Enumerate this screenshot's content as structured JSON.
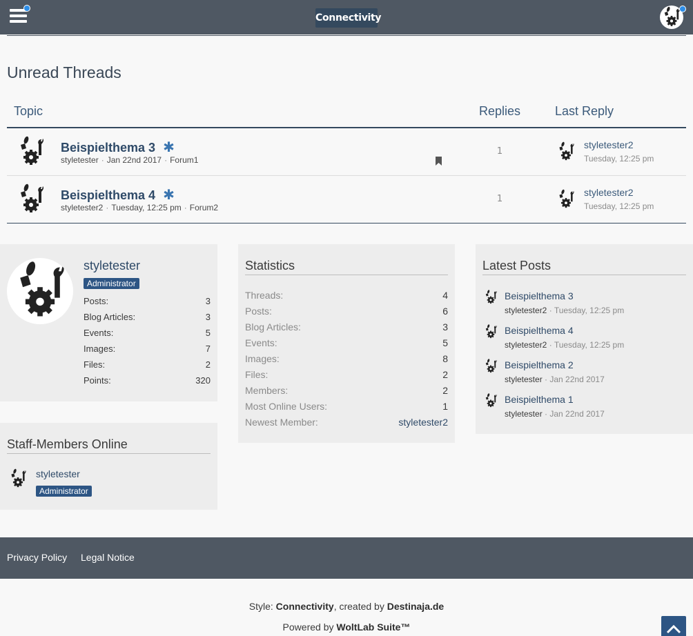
{
  "header": {
    "logo_text": "Connectivity",
    "menu_icon": "hamburger-icon",
    "user_avatar_icon": "tools-avatar-icon"
  },
  "unread": {
    "title": "Unread Threads",
    "columns": {
      "topic": "Topic",
      "replies": "Replies",
      "last_reply": "Last Reply"
    },
    "threads": [
      {
        "title": "Beispielthema 3",
        "author": "styletester",
        "date": "Jan 22nd 2017",
        "forum": "Forum1",
        "replies": "1",
        "last_user": "styletester2",
        "last_time": "Tuesday, 12:25 pm",
        "bookmarked": true
      },
      {
        "title": "Beispielthema 4",
        "author": "styletester2",
        "date": "Tuesday, 12:25 pm",
        "forum": "Forum2",
        "replies": "1",
        "last_user": "styletester2",
        "last_time": "Tuesday, 12:25 pm",
        "bookmarked": false
      }
    ]
  },
  "user_box": {
    "username": "styletester",
    "rank": "Administrator",
    "stats": [
      {
        "label": "Posts:",
        "value": "3"
      },
      {
        "label": "Blog Articles:",
        "value": "3"
      },
      {
        "label": "Events:",
        "value": "5"
      },
      {
        "label": "Images:",
        "value": "7"
      },
      {
        "label": "Files:",
        "value": "2"
      },
      {
        "label": "Points:",
        "value": "320"
      }
    ]
  },
  "staff_box": {
    "title": "Staff-Members Online",
    "username": "styletester",
    "rank": "Administrator"
  },
  "statistics": {
    "title": "Statistics",
    "rows": [
      {
        "label": "Threads:",
        "value": "4"
      },
      {
        "label": "Posts:",
        "value": "6"
      },
      {
        "label": "Blog Articles:",
        "value": "3"
      },
      {
        "label": "Events:",
        "value": "5"
      },
      {
        "label": "Images:",
        "value": "8"
      },
      {
        "label": "Files:",
        "value": "2"
      },
      {
        "label": "Members:",
        "value": "2"
      },
      {
        "label": "Most Online Users:",
        "value": "1"
      },
      {
        "label": "Newest Member:",
        "value": "styletester2"
      }
    ]
  },
  "latest_posts": {
    "title": "Latest Posts",
    "posts": [
      {
        "title": "Beispielthema 3",
        "user": "styletester2",
        "time": "Tuesday, 12:25 pm"
      },
      {
        "title": "Beispielthema 4",
        "user": "styletester2",
        "time": "Tuesday, 12:25 pm"
      },
      {
        "title": "Beispielthema 2",
        "user": "styletester",
        "time": "Jan 22nd 2017"
      },
      {
        "title": "Beispielthema 1",
        "user": "styletester",
        "time": "Jan 22nd 2017"
      }
    ]
  },
  "footer": {
    "links": [
      "Privacy Policy",
      "Legal Notice"
    ],
    "style_prefix": "Style: ",
    "style_name": "Connectivity",
    "created_by": ", created by ",
    "author": "Destinaja.de",
    "powered_prefix": "Powered by ",
    "powered_name": "WoltLab Suite™"
  },
  "colors": {
    "header_bg": "#4f5863",
    "accent": "#2d5584",
    "notification": "#2e8ee8"
  }
}
